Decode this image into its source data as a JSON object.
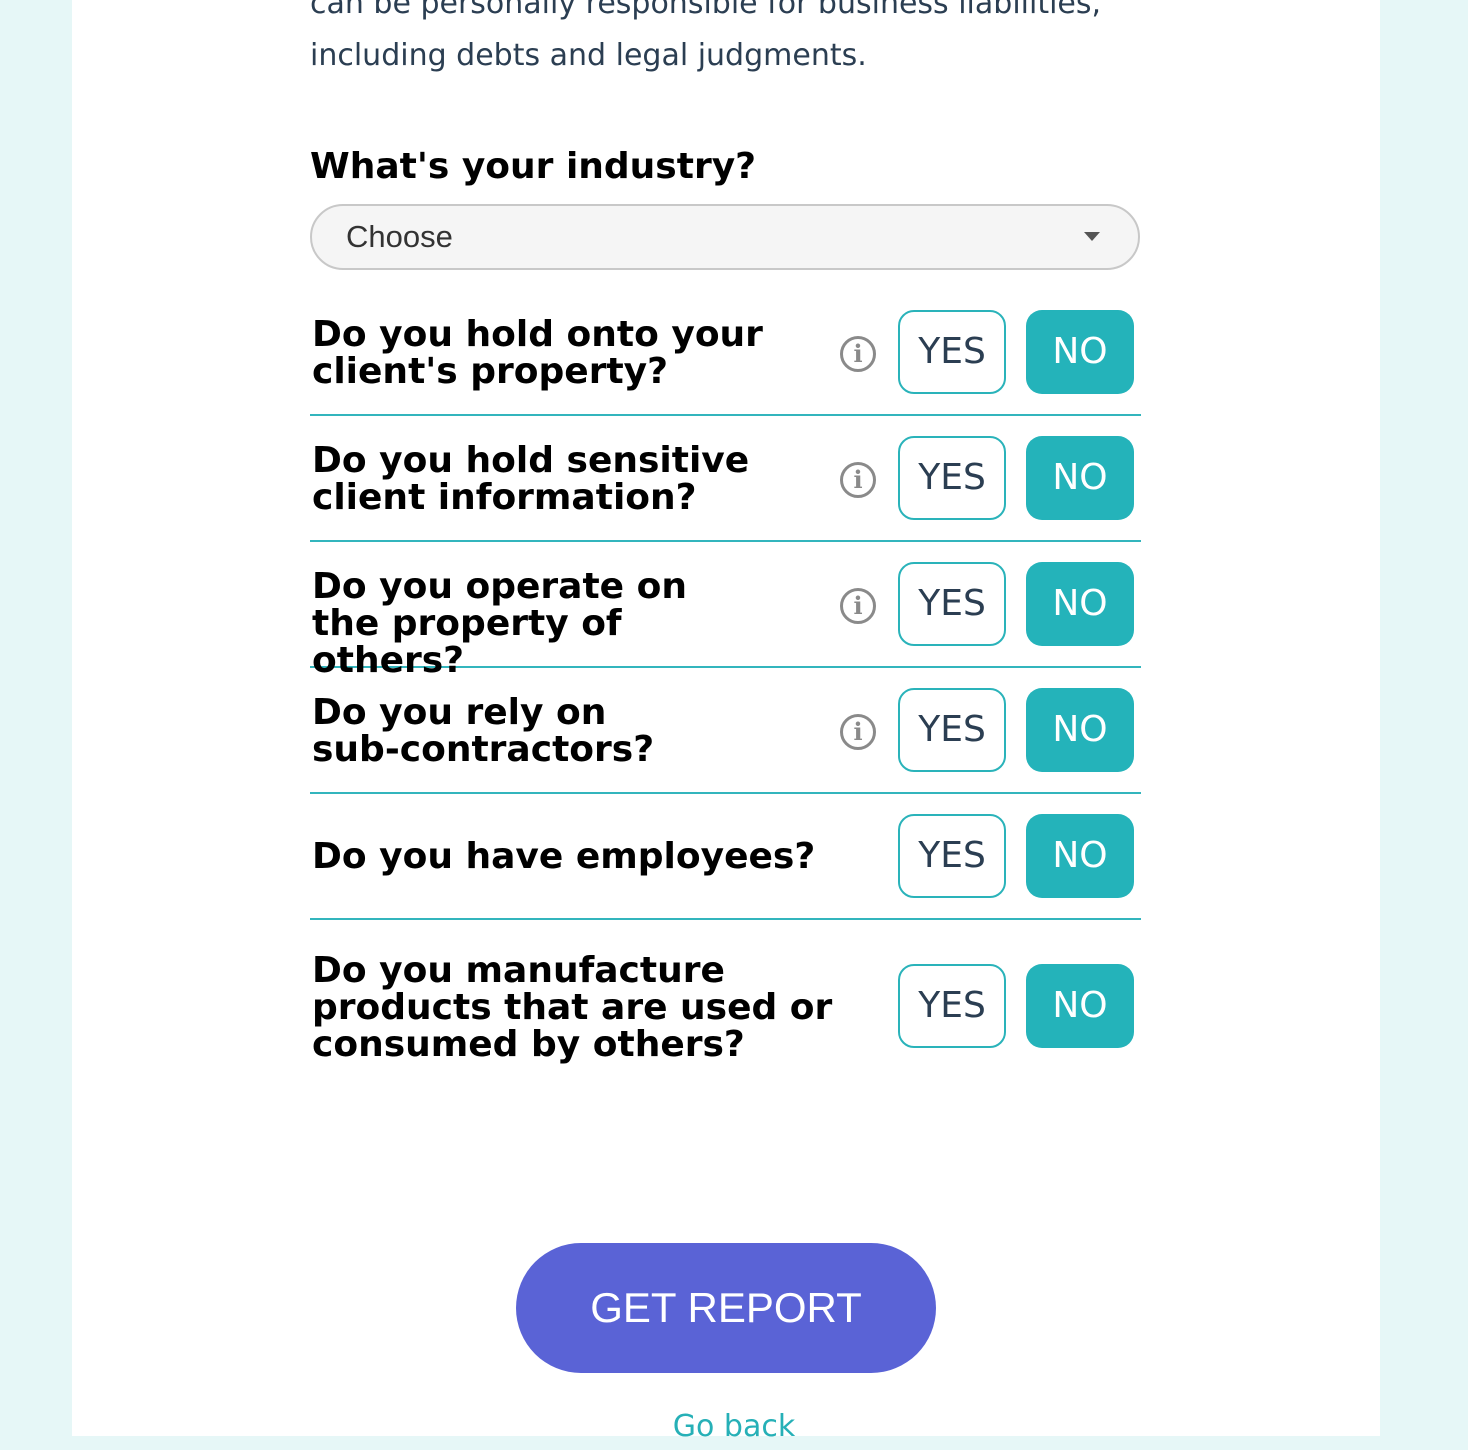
{
  "intro": {
    "line1": "can be personally responsible for business liabilities,",
    "line2": "including debts and legal judgments."
  },
  "industry": {
    "label": "What's your industry?",
    "selected": "Choose"
  },
  "questions": [
    {
      "text": "Do you hold onto your client's property?",
      "yes": "YES",
      "no": "NO",
      "selected": "NO"
    },
    {
      "text": "Do you hold sensitive client information?",
      "yes": "YES",
      "no": "NO",
      "selected": "NO"
    },
    {
      "text": "Do you operate on the property of others?",
      "yes": "YES",
      "no": "NO",
      "selected": "NO"
    },
    {
      "text": "Do you rely on sub-contractors?",
      "yes": "YES",
      "no": "NO",
      "selected": "NO"
    },
    {
      "text": "Do you have employees?",
      "yes": "YES",
      "no": "NO",
      "selected": "NO"
    },
    {
      "text": "Do you manufacture products that are used or consumed by others?",
      "yes": "YES",
      "no": "NO",
      "selected": "NO"
    }
  ],
  "info_icon_glyph": "i",
  "actions": {
    "get_report": "GET REPORT",
    "go_back": "Go back"
  },
  "colors": {
    "accent": "#24b3ba",
    "primary_button": "#5a63d6",
    "background": "#e6f7f7"
  }
}
